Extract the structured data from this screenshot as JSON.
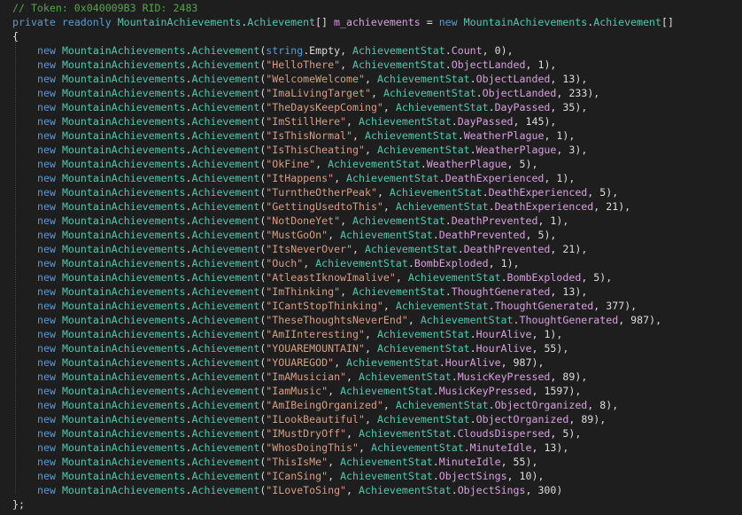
{
  "comment_line": "// Token: 0x040009B3 RID: 2483",
  "declaration": {
    "kw_private": "private",
    "kw_readonly": "readonly",
    "type_class": "MountainAchievements",
    "type_member": "Achievement",
    "array_brackets": "[]",
    "field_name": "m_achievements",
    "equals": "=",
    "kw_new": "new"
  },
  "open_brace": "{",
  "close_brace": "};",
  "entries": [
    {
      "arg": "string.Empty",
      "stat": "Count",
      "value": "0",
      "end": "),"
    },
    {
      "arg": "\"HelloThere\"",
      "stat": "ObjectLanded",
      "value": "1",
      "end": "),"
    },
    {
      "arg": "\"WelcomeWelcome\"",
      "stat": "ObjectLanded",
      "value": "13",
      "end": "),"
    },
    {
      "arg": "\"ImaLivingTarget\"",
      "stat": "ObjectLanded",
      "value": "233",
      "end": "),"
    },
    {
      "arg": "\"TheDaysKeepComing\"",
      "stat": "DayPassed",
      "value": "35",
      "end": "),"
    },
    {
      "arg": "\"ImStillHere\"",
      "stat": "DayPassed",
      "value": "145",
      "end": "),"
    },
    {
      "arg": "\"IsThisNormal\"",
      "stat": "WeatherPlague",
      "value": "1",
      "end": "),"
    },
    {
      "arg": "\"IsThisCheating\"",
      "stat": "WeatherPlague",
      "value": "3",
      "end": "),"
    },
    {
      "arg": "\"OkFine\"",
      "stat": "WeatherPlague",
      "value": "5",
      "end": "),"
    },
    {
      "arg": "\"ItHappens\"",
      "stat": "DeathExperienced",
      "value": "1",
      "end": "),"
    },
    {
      "arg": "\"TurntheOtherPeak\"",
      "stat": "DeathExperienced",
      "value": "5",
      "end": "),"
    },
    {
      "arg": "\"GettingUsedtoThis\"",
      "stat": "DeathExperienced",
      "value": "21",
      "end": "),"
    },
    {
      "arg": "\"NotDoneYet\"",
      "stat": "DeathPrevented",
      "value": "1",
      "end": "),"
    },
    {
      "arg": "\"MustGoOn\"",
      "stat": "DeathPrevented",
      "value": "5",
      "end": "),"
    },
    {
      "arg": "\"ItsNeverOver\"",
      "stat": "DeathPrevented",
      "value": "21",
      "end": "),"
    },
    {
      "arg": "\"Ouch\"",
      "stat": "BombExploded",
      "value": "1",
      "end": "),"
    },
    {
      "arg": "\"AtleastIknowImalive\"",
      "stat": "BombExploded",
      "value": "5",
      "end": "),"
    },
    {
      "arg": "\"ImThinking\"",
      "stat": "ThoughtGenerated",
      "value": "13",
      "end": "),"
    },
    {
      "arg": "\"ICantStopThinking\"",
      "stat": "ThoughtGenerated",
      "value": "377",
      "end": "),"
    },
    {
      "arg": "\"TheseThoughtsNeverEnd\"",
      "stat": "ThoughtGenerated",
      "value": "987",
      "end": "),"
    },
    {
      "arg": "\"AmIInteresting\"",
      "stat": "HourAlive",
      "value": "1",
      "end": "),"
    },
    {
      "arg": "\"YOUAREMOUNTAIN\"",
      "stat": "HourAlive",
      "value": "55",
      "end": "),"
    },
    {
      "arg": "\"YOUAREGOD\"",
      "stat": "HourAlive",
      "value": "987",
      "end": "),"
    },
    {
      "arg": "\"ImAMusician\"",
      "stat": "MusicKeyPressed",
      "value": "89",
      "end": "),"
    },
    {
      "arg": "\"IamMusic\"",
      "stat": "MusicKeyPressed",
      "value": "1597",
      "end": "),"
    },
    {
      "arg": "\"AmIBeingOrganized\"",
      "stat": "ObjectOrganized",
      "value": "8",
      "end": "),"
    },
    {
      "arg": "\"ILookBeautiful\"",
      "stat": "ObjectOrganized",
      "value": "89",
      "end": "),"
    },
    {
      "arg": "\"IMustDryOff\"",
      "stat": "CloudsDispersed",
      "value": "5",
      "end": "),"
    },
    {
      "arg": "\"WhosDoingThis\"",
      "stat": "MinuteIdle",
      "value": "13",
      "end": "),"
    },
    {
      "arg": "\"ThisIsMe\"",
      "stat": "MinuteIdle",
      "value": "55",
      "end": "),"
    },
    {
      "arg": "\"ICanSing\"",
      "stat": "ObjectSings",
      "value": "10",
      "end": "),"
    },
    {
      "arg": "\"ILoveToSing\"",
      "stat": "ObjectSings",
      "value": "300",
      "end": ")"
    }
  ],
  "entry_parts": {
    "kw_new": "new",
    "ctor": "MountainAchievements.Achievement(",
    "stat_type": "AchievementStat"
  },
  "colors": {
    "background": "#1e1e1e",
    "comment": "#57a64a",
    "keyword": "#569cd6",
    "type": "#4ec9b0",
    "field": "#d8a0df",
    "string": "#d69d85",
    "number": "#b5cea8",
    "plain": "#dcdcdc"
  }
}
